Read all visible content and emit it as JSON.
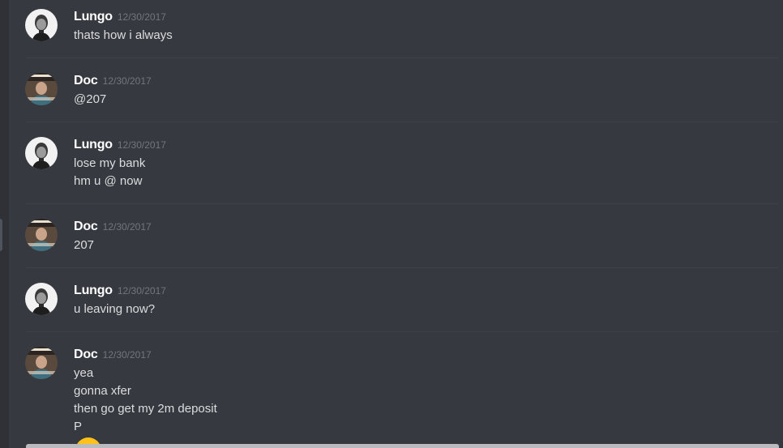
{
  "messages": [
    {
      "author": "Lungo",
      "timestamp": "12/30/2017",
      "avatar": "lungo-avatar",
      "lines": [
        "thats how i always"
      ]
    },
    {
      "author": "Doc",
      "timestamp": "12/30/2017",
      "avatar": "doc-avatar",
      "lines": [
        "@207"
      ]
    },
    {
      "author": "Lungo",
      "timestamp": "12/30/2017",
      "avatar": "lungo-avatar",
      "lines": [
        "lose my bank",
        "hm u @ now"
      ]
    },
    {
      "author": "Doc",
      "timestamp": "12/30/2017",
      "avatar": "doc-avatar",
      "lines": [
        "207"
      ]
    },
    {
      "author": "Lungo",
      "timestamp": "12/30/2017",
      "avatar": "lungo-avatar",
      "lines": [
        "u leaving now?"
      ]
    },
    {
      "author": "Doc",
      "timestamp": "12/30/2017",
      "avatar": "doc-avatar",
      "lines": [
        "yea",
        "gonna xfer",
        "then go get my 2m deposit",
        "P"
      ]
    }
  ],
  "colors": {
    "background": "#36393f",
    "username": "#ffffff",
    "timestamp": "#72767d",
    "message_text": "#dcddde",
    "divider": "#3e4147"
  }
}
